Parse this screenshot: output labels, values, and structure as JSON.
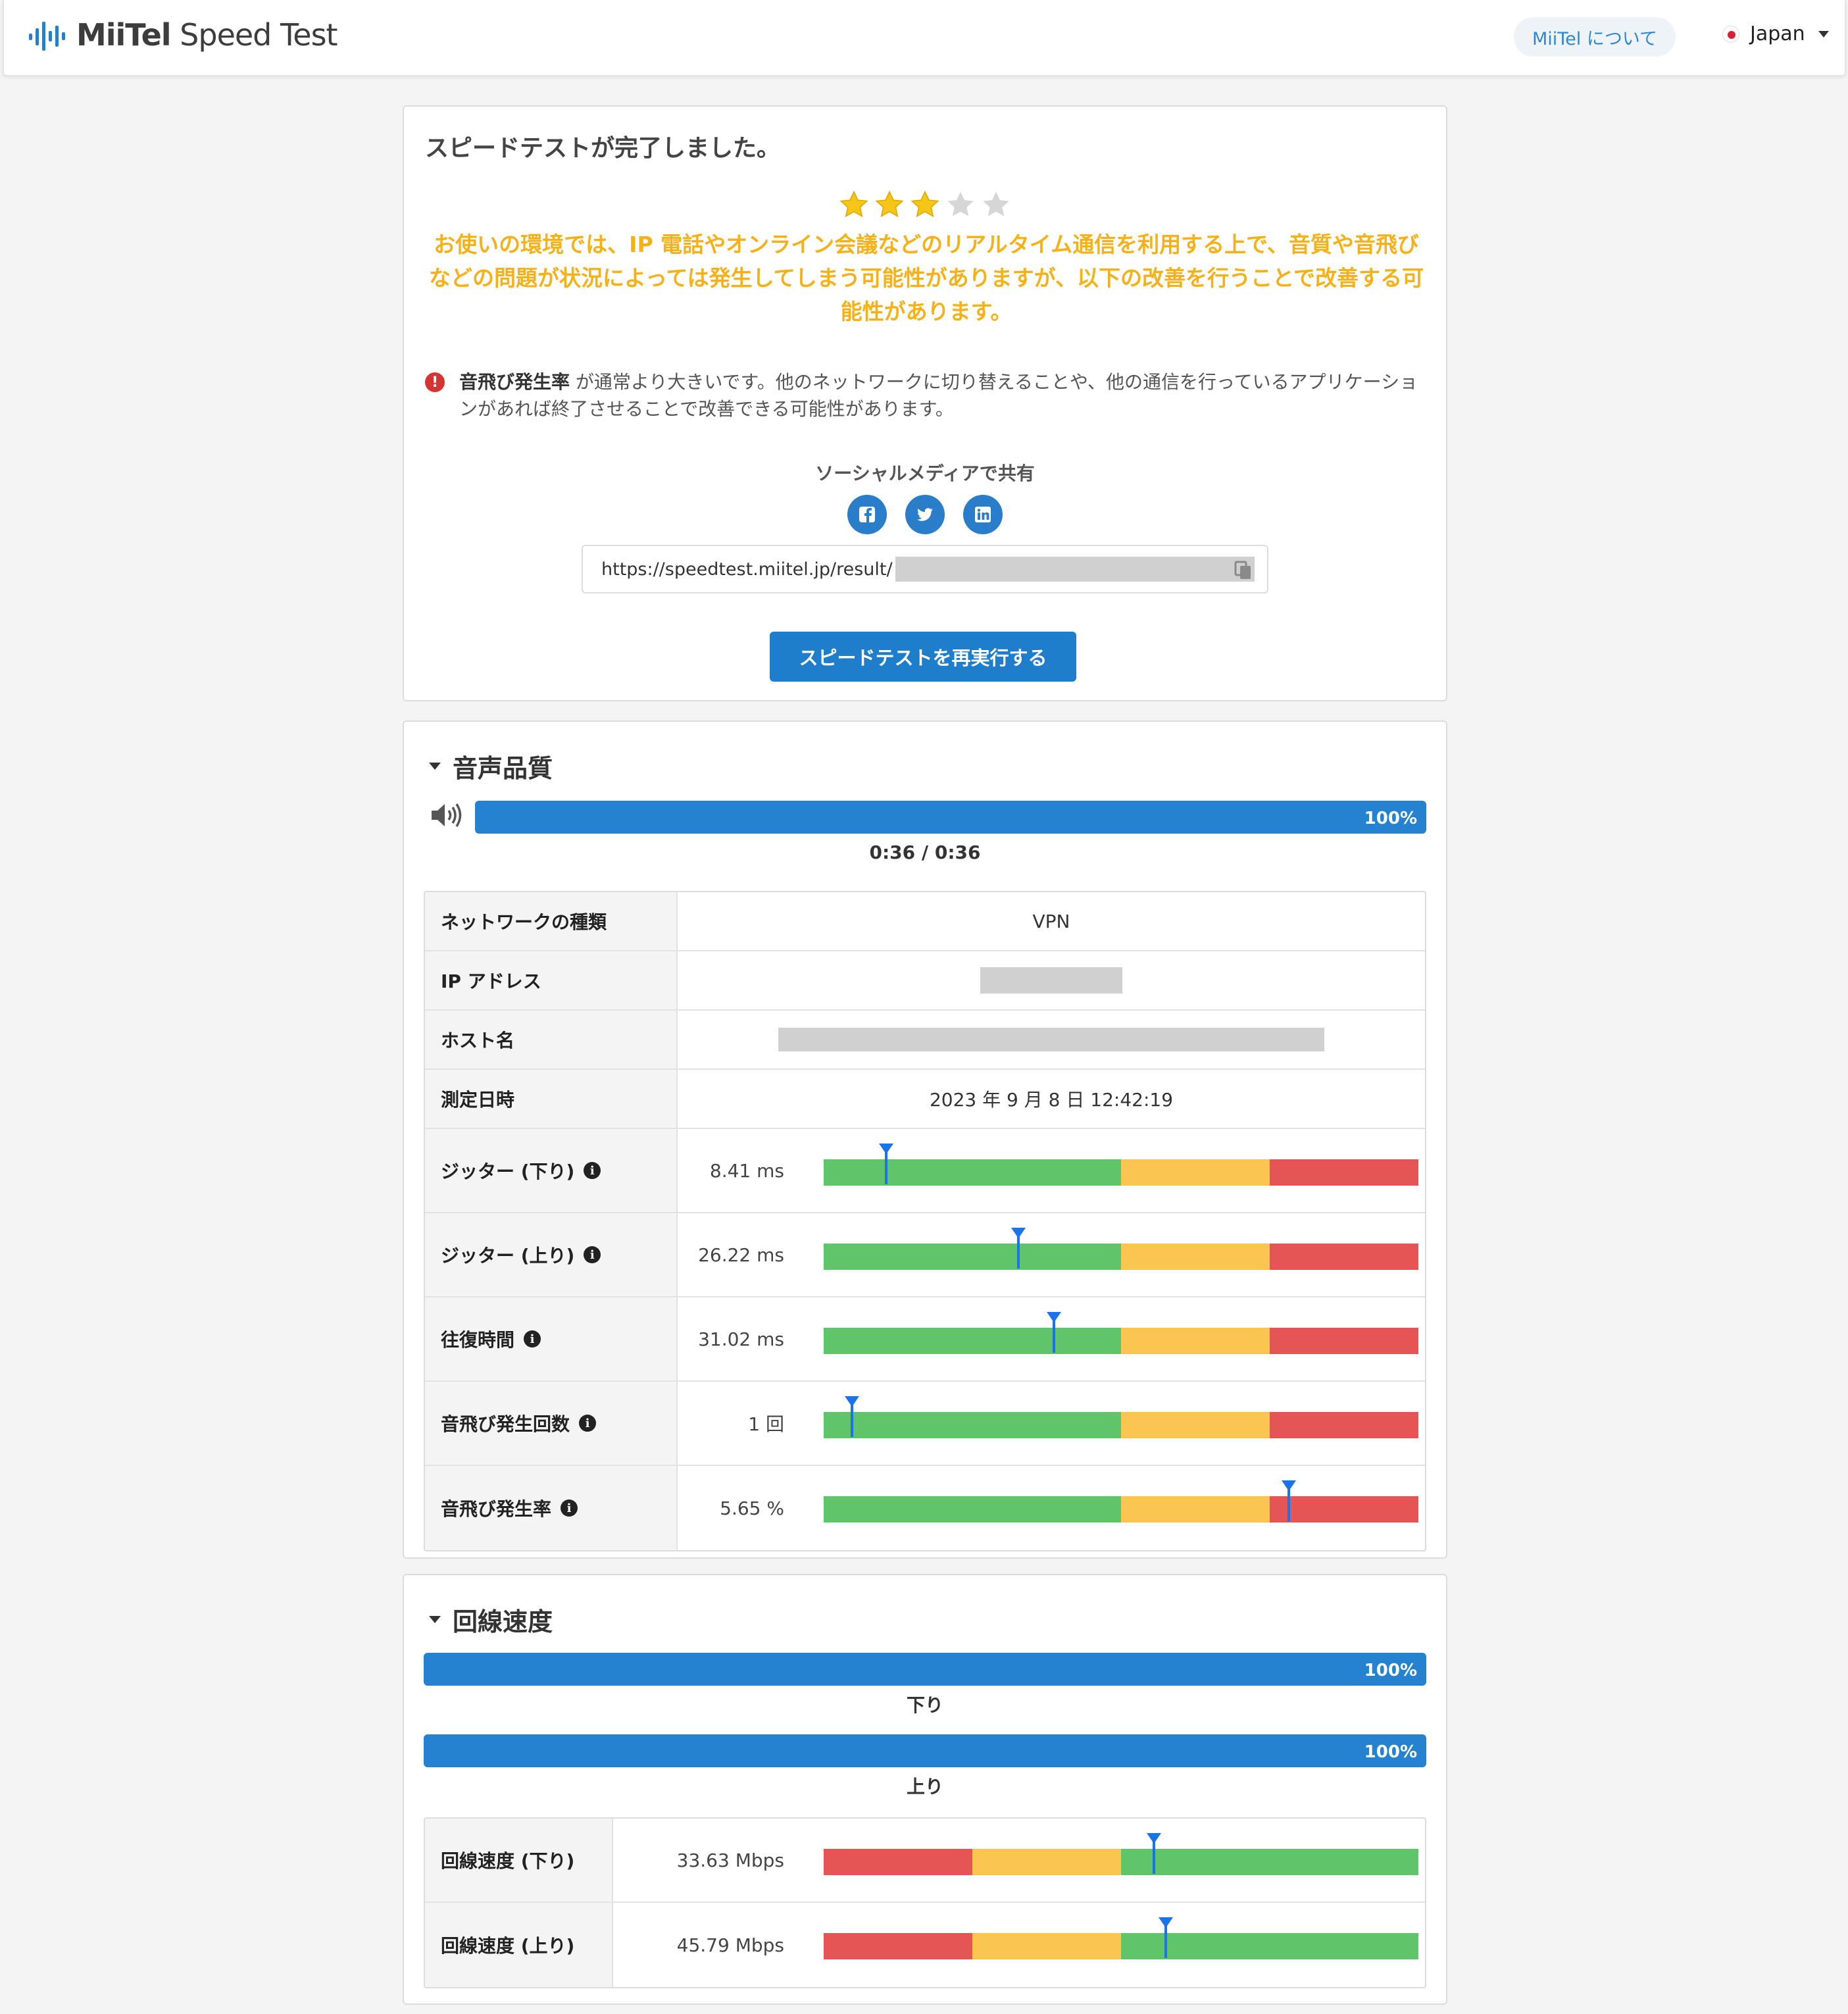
{
  "header": {
    "logo_brand": "MiiTel",
    "logo_product": "Speed Test",
    "about_label": "MiiTel について",
    "language_label": "Japan"
  },
  "result": {
    "title": "スピードテストが完了しました。",
    "stars_filled": 3,
    "stars_total": 5,
    "message": "お使いの環境では、IP 電話やオンライン会議などのリアルタイム通信を利用する上で、音質や音飛びなどの問題が状況によっては発生してしまう可能性がありますが、以下の改善を行うことで改善する可能性があります。",
    "alert_strong": "音飛び発生率",
    "alert_text": " が通常より大きいです。他のネットワークに切り替えることや、他の通信を行っているアプリケーションがあれば終了させることで改善できる可能性があります。",
    "share_label": "ソーシャルメディアで共有",
    "share_icons": [
      "facebook-icon",
      "twitter-icon",
      "linkedin-icon"
    ],
    "url_prefix": "https://speedtest.miitel.jp/result/",
    "rerun_label": "スピードテストを再実行する"
  },
  "voice": {
    "title": "音声品質",
    "progress_label": "100%",
    "progress_percent": 100,
    "time_label": "0:36 / 0:36",
    "info_rows": [
      {
        "label": "ネットワークの種類",
        "value": "VPN"
      },
      {
        "label": "IP アドレス",
        "value": ""
      },
      {
        "label": "ホスト名",
        "value": ""
      },
      {
        "label": "測定日時",
        "value": "2023 年 9 月 8 日 12:42:19"
      }
    ],
    "metrics": [
      {
        "label": "ジッター (下り)",
        "value": "8.41 ms",
        "marker_fraction": 0.105
      },
      {
        "label": "ジッター (上り)",
        "value": "26.22 ms",
        "marker_fraction": 0.327
      },
      {
        "label": "往復時間",
        "value": "31.02 ms",
        "marker_fraction": 0.387
      },
      {
        "label": "音飛び発生回数",
        "value": "1 回",
        "marker_fraction": 0.048
      },
      {
        "label": "音飛び発生率",
        "value": "5.65 %",
        "marker_fraction": 0.782
      }
    ]
  },
  "speed": {
    "title": "回線速度",
    "download_progress_label": "100%",
    "download_caption": "下り",
    "upload_progress_label": "100%",
    "upload_caption": "上り",
    "metrics": [
      {
        "label": "回線速度 (下り)",
        "value": "33.63 Mbps",
        "marker_fraction": 0.555
      },
      {
        "label": "回線速度 (上り)",
        "value": "45.79 Mbps",
        "marker_fraction": 0.575
      }
    ]
  },
  "colors": {
    "accent": "#2582d0",
    "rating": "#f6b118",
    "good": "#5fc46a",
    "warn": "#fbc650",
    "bad": "#e55555",
    "marker": "#1a73e8"
  }
}
